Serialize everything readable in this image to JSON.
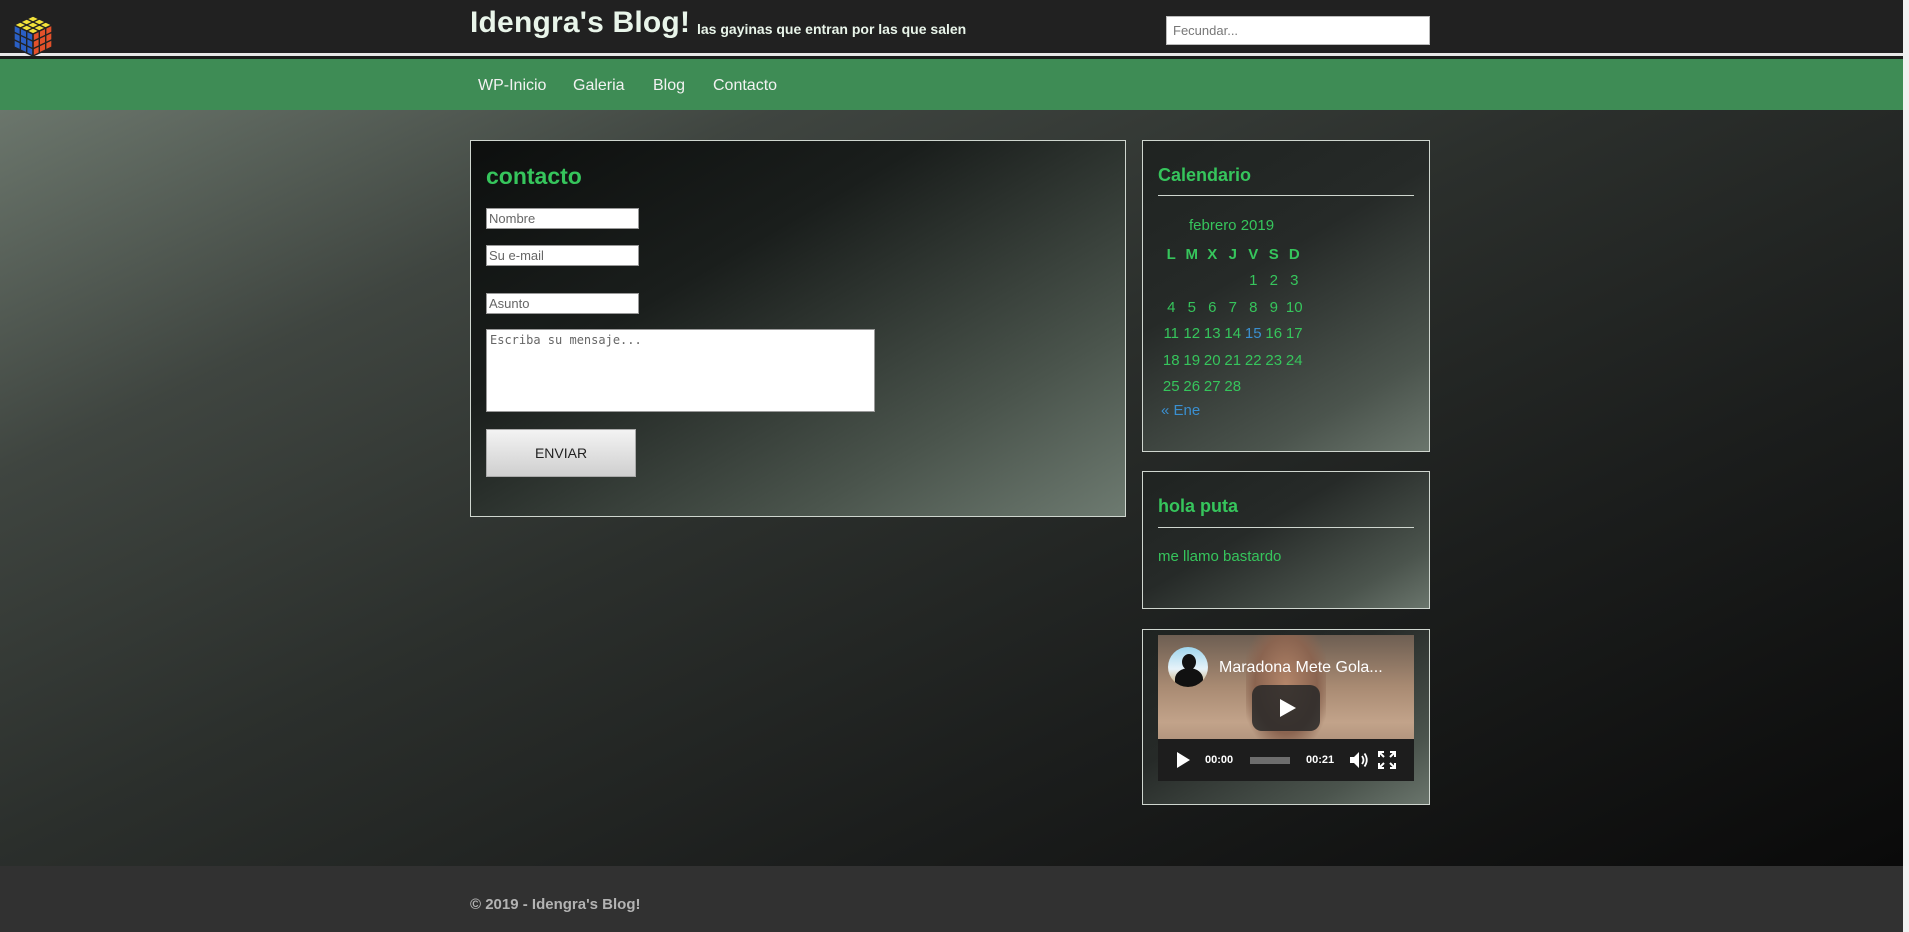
{
  "header": {
    "site_title": "Idengra's Blog!",
    "tagline": "las gayinas que entran por las que salen",
    "search_placeholder": "Fecundar..."
  },
  "nav": {
    "items": [
      {
        "label": "WP-Inicio"
      },
      {
        "label": "Galeria"
      },
      {
        "label": "Blog"
      },
      {
        "label": "Contacto"
      }
    ]
  },
  "contact": {
    "title": "contacto",
    "name_placeholder": "Nombre",
    "email_placeholder": "Su e-mail",
    "subject_placeholder": "Asunto",
    "message_placeholder": "Escriba su mensaje...",
    "send_label": "ENVIAR"
  },
  "calendar": {
    "title": "Calendario",
    "caption": "febrero 2019",
    "weekdays": [
      "L",
      "M",
      "X",
      "J",
      "V",
      "S",
      "D"
    ],
    "weeks": [
      [
        "",
        "",
        "",
        "",
        "1",
        "2",
        "3"
      ],
      [
        "4",
        "5",
        "6",
        "7",
        "8",
        "9",
        "10"
      ],
      [
        "11",
        "12",
        "13",
        "14",
        "15",
        "16",
        "17"
      ],
      [
        "18",
        "19",
        "20",
        "21",
        "22",
        "23",
        "24"
      ],
      [
        "25",
        "26",
        "27",
        "28",
        "",
        "",
        ""
      ]
    ],
    "today": "15",
    "prev_link": "« Ene"
  },
  "hola_widget": {
    "title": "hola puta",
    "text": "me llamo bastardo"
  },
  "video": {
    "title": "Maradona Mete Gola...",
    "current_time": "00:00",
    "duration": "00:21"
  },
  "footer": {
    "text": "© 2019 - Idengra's Blog!"
  },
  "colors": {
    "accent_green": "#36c55c",
    "nav_green": "#3e8c55",
    "link_blue": "#3a8fd0"
  }
}
